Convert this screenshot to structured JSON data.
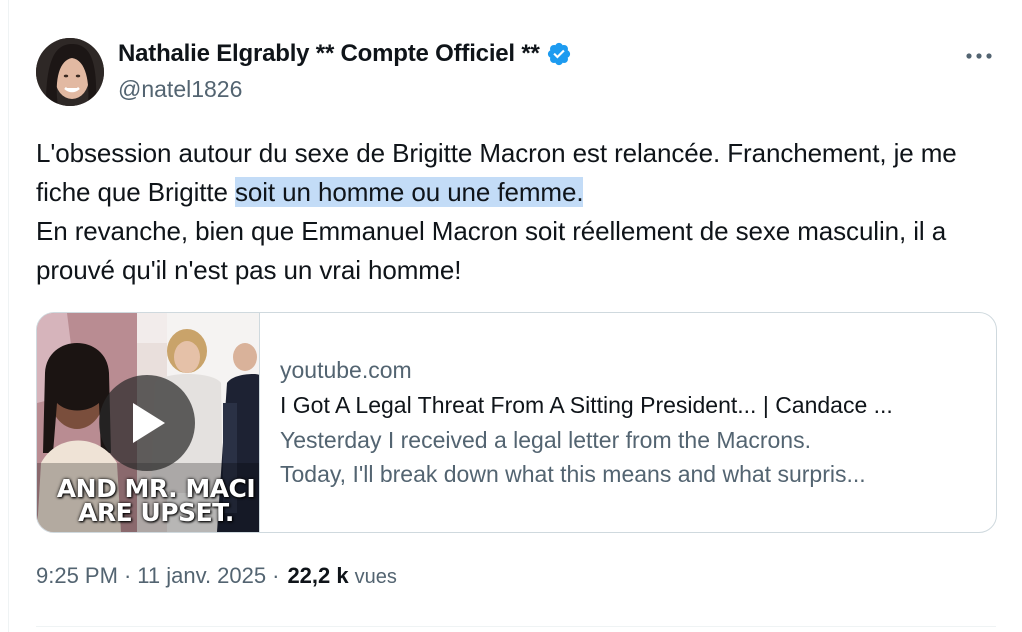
{
  "author": {
    "display_name": "Nathalie Elgrably ** Compte Officiel **",
    "handle": "@natel1826",
    "verified_icon": "verified-badge-icon"
  },
  "tweet": {
    "text_part1": "L'obsession autour du sexe de Brigitte Macron est relancée.  Franchement, je me fiche que Brigitte ",
    "text_highlight": "soit un homme ou une femme.",
    "text_line3": "En revanche, bien que Emmanuel Macron soit réellement de sexe masculin, il a prouvé qu'il n'est pas un vrai homme!"
  },
  "link_card": {
    "domain": "youtube.com",
    "title": "I Got A Legal Threat From A Sitting President... | Candace ...",
    "description_line1": "Yesterday I received a legal letter from the Macrons.",
    "description_line2": "Today, I'll break down what this means and what surpris...",
    "thumbnail_caption_line1": "AND MR. MACI",
    "thumbnail_caption_line2": "ARE UPSET."
  },
  "meta": {
    "time": "9:25 PM",
    "separator": "·",
    "date": "11 janv. 2025",
    "views_count": "22,2 k",
    "views_label": "vues"
  },
  "colors": {
    "text_primary": "#0f1419",
    "text_secondary": "#536471",
    "verified_blue": "#1d9bf0",
    "highlight": "#c3dcf7",
    "border": "#cfd9de"
  }
}
